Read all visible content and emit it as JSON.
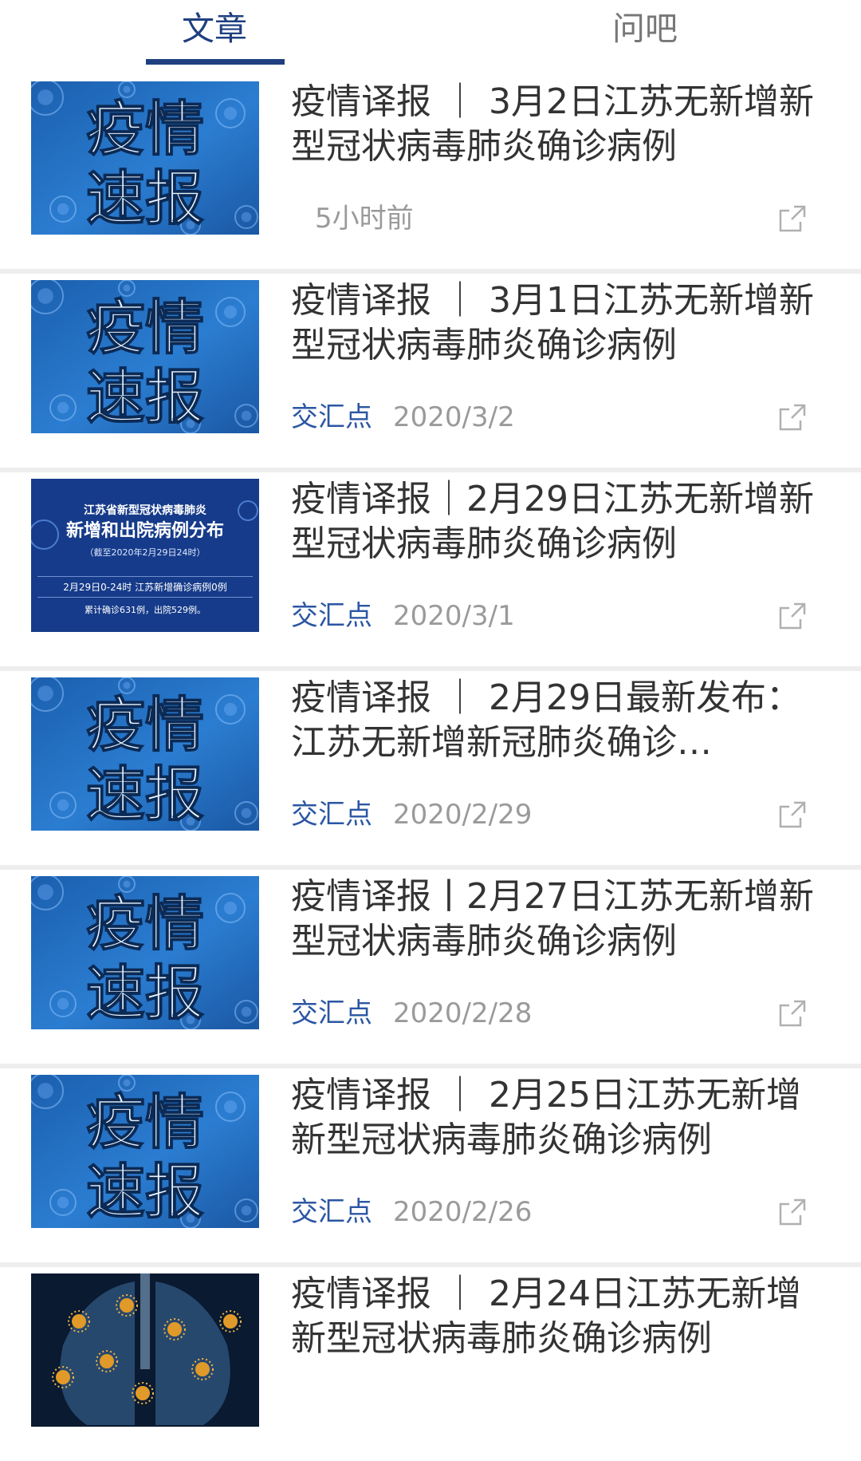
{
  "tabs": {
    "articles": "文章",
    "qa": "问吧"
  },
  "colors": {
    "accent": "#1f3f80",
    "source_text": "#2b56a3",
    "title_text": "#333333",
    "meta_text": "#9a9a9a",
    "divider": "#eeeeee"
  },
  "articles": [
    {
      "title": "疫情译报 ｜ 3月2日江苏无新增新型冠状病毒肺炎确诊病例",
      "source": "",
      "date": "5小时前",
      "thumbnail": "epidemic-bulletin",
      "thumb_text": {
        "line1": "疫情",
        "line2": "速报"
      }
    },
    {
      "title": "疫情译报 ｜ 3月1日江苏无新增新型冠状病毒肺炎确诊病例",
      "source": "交汇点",
      "date": "2020/3/2",
      "thumbnail": "epidemic-bulletin",
      "thumb_text": {
        "line1": "疫情",
        "line2": "速报"
      }
    },
    {
      "title": "疫情译报｜2月29日江苏无新增新型冠状病毒肺炎确诊病例",
      "source": "交汇点",
      "date": "2020/3/1",
      "thumbnail": "case-distribution-map",
      "thumb_text": {
        "line1": "江苏省新型冠状病毒肺炎",
        "line2": "新增和出院病例分布",
        "line3": "（截至2020年2月29日24时）",
        "line4": "2月29日0-24时 江苏新增确诊病例0例",
        "line5": "累计确诊631例，出院529例。"
      }
    },
    {
      "title": "疫情译报 ｜ 2月29日最新发布：江苏无新增新冠肺炎确诊…",
      "source": "交汇点",
      "date": "2020/2/29",
      "thumbnail": "epidemic-bulletin",
      "thumb_text": {
        "line1": "疫情",
        "line2": "速报"
      }
    },
    {
      "title": "疫情译报丨2月27日江苏无新增新型冠状病毒肺炎确诊病例",
      "source": "交汇点",
      "date": "2020/2/28",
      "thumbnail": "epidemic-bulletin",
      "thumb_text": {
        "line1": "疫情",
        "line2": "速报"
      }
    },
    {
      "title": "疫情译报 ｜ 2月25日江苏无新增新型冠状病毒肺炎确诊病例",
      "source": "交汇点",
      "date": "2020/2/26",
      "thumbnail": "epidemic-bulletin",
      "thumb_text": {
        "line1": "疫情",
        "line2": "速报"
      }
    },
    {
      "title": "疫情译报 ｜ 2月24日江苏无新增新型冠状病毒肺炎确诊病例",
      "source": "",
      "date": "",
      "thumbnail": "lungs-virus",
      "thumb_text": {}
    }
  ]
}
